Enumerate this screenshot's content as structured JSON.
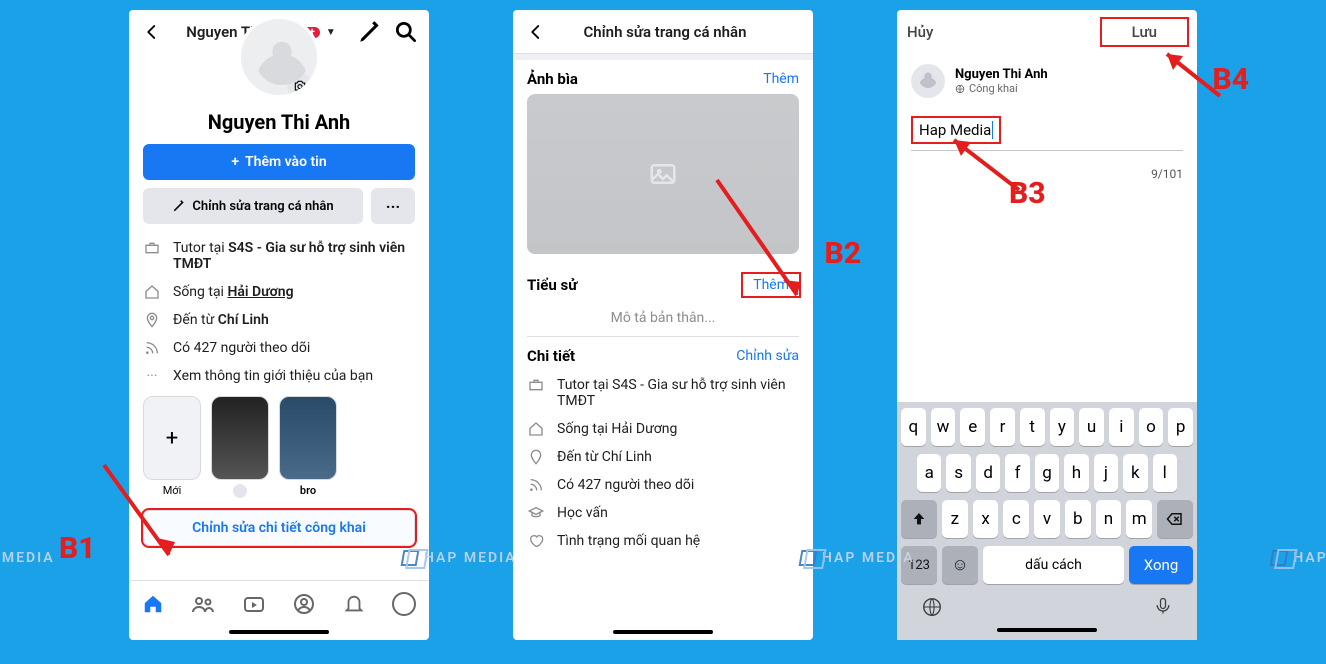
{
  "annotations": {
    "b1": "B1",
    "b2": "B2",
    "b3": "B3",
    "b4": "B4"
  },
  "watermark": "HAP MEDIA",
  "phone1": {
    "header": {
      "name": "Nguyen Thi Anh",
      "badge": "9+"
    },
    "profile_name": "Nguyen Thi Anh",
    "add_story": "Thêm vào tin",
    "edit_profile": "Chỉnh sửa trang cá nhân",
    "more": "···",
    "details": {
      "work_prefix": "Tutor tại ",
      "work_bold": "S4S - Gia sư hỗ trợ sinh viên TMĐT",
      "live_prefix": "Sống tại ",
      "live_bold": "Hải Dương",
      "from_prefix": "Đến từ ",
      "from_bold": "Chí Linh",
      "followers": "Có 427 người theo dõi",
      "see_more": "Xem thông tin giới thiệu của bạn"
    },
    "stories": {
      "new": "Mới",
      "s1": "",
      "s2": "bro",
      "new_plus": "+"
    },
    "edit_public": "Chỉnh sửa chi tiết công khai"
  },
  "phone2": {
    "title": "Chỉnh sửa trang cá nhân",
    "cover_title": "Ảnh bìa",
    "cover_add": "Thêm",
    "bio_title": "Tiểu sử",
    "bio_add": "Thêm",
    "bio_placeholder": "Mô tả bản thân...",
    "detail_title": "Chi tiết",
    "detail_edit": "Chỉnh sửa",
    "rows": {
      "work_prefix": "Tutor tại",
      "work_rest": "S4S - Gia sư hỗ trợ sinh viên TMĐT",
      "live": "Sống tại Hải Dương",
      "from": "Đến từ Chí Linh",
      "followers": "Có 427 người theo dõi",
      "education": "Học vấn",
      "relationship": "Tình trạng mối quan hệ"
    }
  },
  "phone3": {
    "cancel": "Hủy",
    "save": "Lưu",
    "name": "Nguyen Thi Anh",
    "privacy": "Công khai",
    "bio_value": "Hap Media",
    "counter": "9/101",
    "keyboard": {
      "r1": [
        "q",
        "w",
        "e",
        "r",
        "t",
        "y",
        "u",
        "i",
        "o",
        "p"
      ],
      "r2": [
        "a",
        "s",
        "d",
        "f",
        "g",
        "h",
        "j",
        "k",
        "l"
      ],
      "r3": [
        "z",
        "x",
        "c",
        "v",
        "b",
        "n",
        "m"
      ],
      "num": "123",
      "space": "dấu cách",
      "done": "Xong"
    }
  }
}
